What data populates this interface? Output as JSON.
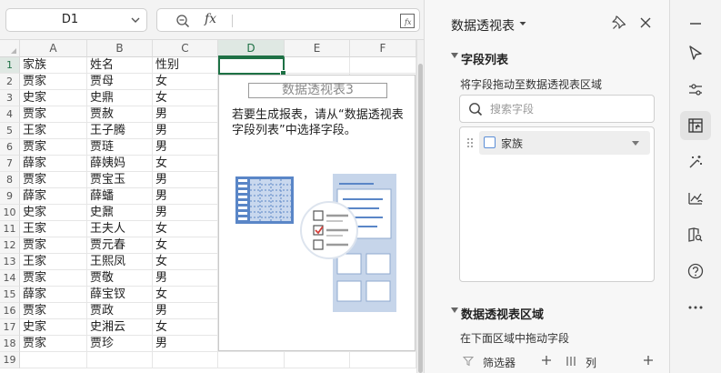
{
  "namebox": {
    "value": "D1"
  },
  "formula": {
    "fx": "fx",
    "value": ""
  },
  "columns": [
    "A",
    "B",
    "C",
    "D",
    "E",
    "F"
  ],
  "active_column": "D",
  "rows": [
    {
      "num": "1",
      "a": "家族",
      "b": "姓名",
      "c": "性别"
    },
    {
      "num": "2",
      "a": "贾家",
      "b": "贾母",
      "c": "女"
    },
    {
      "num": "3",
      "a": "史家",
      "b": "史鼎",
      "c": "女"
    },
    {
      "num": "4",
      "a": "贾家",
      "b": "贾赦",
      "c": "男"
    },
    {
      "num": "5",
      "a": "王家",
      "b": "王子腾",
      "c": "男"
    },
    {
      "num": "6",
      "a": "贾家",
      "b": "贾琏",
      "c": "男"
    },
    {
      "num": "7",
      "a": "薛家",
      "b": "薛姨妈",
      "c": "女"
    },
    {
      "num": "8",
      "a": "贾家",
      "b": "贾宝玉",
      "c": "男"
    },
    {
      "num": "9",
      "a": "薛家",
      "b": "薛蟠",
      "c": "男"
    },
    {
      "num": "10",
      "a": "史家",
      "b": "史鼐",
      "c": "男"
    },
    {
      "num": "11",
      "a": "王家",
      "b": "王夫人",
      "c": "女"
    },
    {
      "num": "12",
      "a": "贾家",
      "b": "贾元春",
      "c": "女"
    },
    {
      "num": "13",
      "a": "王家",
      "b": "王熙凤",
      "c": "女"
    },
    {
      "num": "14",
      "a": "贾家",
      "b": "贾敬",
      "c": "男"
    },
    {
      "num": "15",
      "a": "薛家",
      "b": "薛宝钗",
      "c": "女"
    },
    {
      "num": "16",
      "a": "贾家",
      "b": "贾政",
      "c": "男"
    },
    {
      "num": "17",
      "a": "史家",
      "b": "史湘云",
      "c": "女"
    },
    {
      "num": "18",
      "a": "贾家",
      "b": "贾珍",
      "c": "男"
    },
    {
      "num": "19",
      "a": "",
      "b": "",
      "c": ""
    }
  ],
  "pivot": {
    "title": "数据透视表3",
    "hint": "若要生成报表，请从“数据透视表字段列表”中选择字段。"
  },
  "panel": {
    "title": "数据透视表",
    "field_list_title": "字段列表",
    "drag_hint": "将字段拖动至数据透视表区域",
    "search_placeholder": "搜索字段",
    "fields": [
      {
        "label": "家族",
        "checked": false
      }
    ],
    "areas_title": "数据透视表区域",
    "areas_hint": "在下面区域中拖动字段",
    "filter_label": "筛选器",
    "column_label": "列"
  },
  "rail_icons": [
    "minimize-icon",
    "select-cursor-icon",
    "adjust-icon",
    "pivot-table-icon",
    "magic-icon",
    "chart-icon",
    "book-search-icon",
    "help-icon",
    "more-icon"
  ],
  "colors": {
    "accent": "#1e7145",
    "checkbox": "#5b8ed6",
    "illustration": "#5a86c7"
  }
}
